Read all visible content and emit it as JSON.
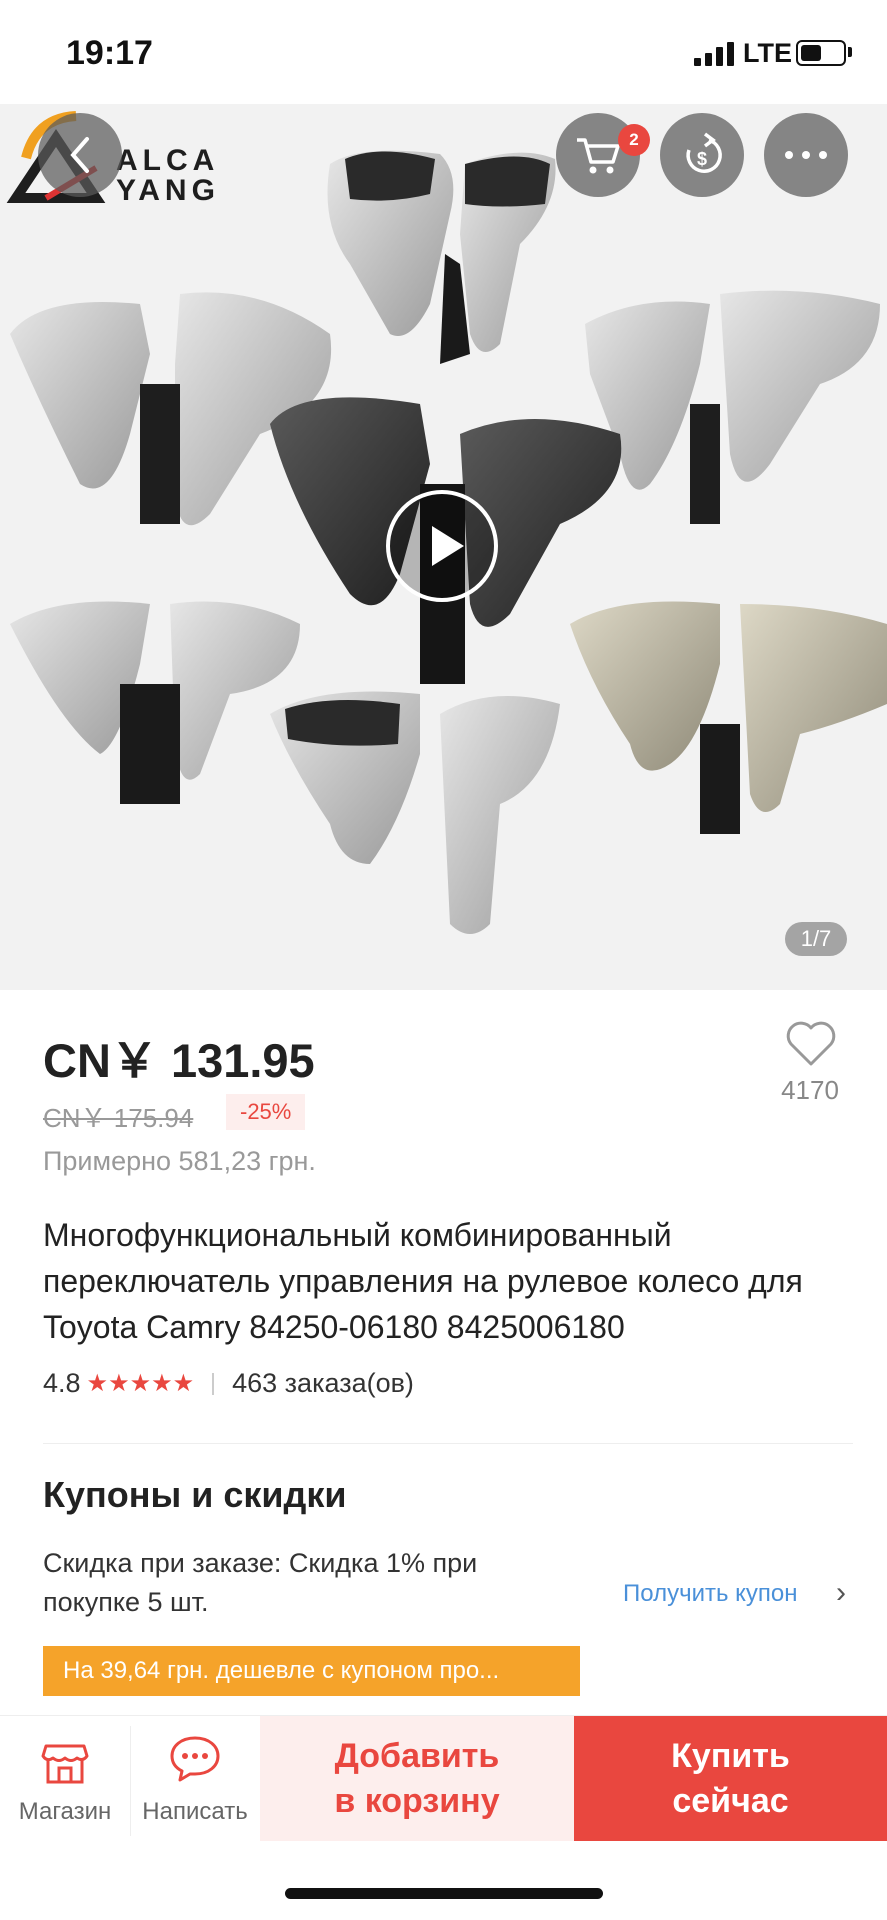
{
  "status_bar": {
    "time": "19:17",
    "network": "LTE"
  },
  "hero": {
    "brand_line1": "ALCA",
    "brand_line2": "YANG",
    "cart_badge": "2",
    "image_counter": "1/7"
  },
  "product": {
    "price": "CN￥ 131.95",
    "old_price": "CN￥ 175.94",
    "discount": "-25%",
    "approx_price": "Примерно 581,23 грн.",
    "favorites_count": "4170",
    "title": "Многофункциональный комбинированный переключатель управления на рулевое колесо для Toyota Camry 84250-06180 8425006180",
    "rating": "4.8",
    "stars_value": 4.8,
    "orders": "463 заказа(ов)"
  },
  "coupons": {
    "heading": "Купоны и скидки",
    "discount_text": "Скидка при заказе: Скидка 1% при покупке 5 шт.",
    "get_coupon_label": "Получить купон",
    "banner": "На 39,64 грн. дешевле с купоном про..."
  },
  "bottom_bar": {
    "store_label": "Магазин",
    "message_label": "Написать",
    "add_to_cart": "Добавить в корзину",
    "buy_now": "Купить сейчас"
  },
  "colors": {
    "accent": "#e9473f",
    "coupon_banner": "#f5a32a",
    "link": "#4a90d9"
  }
}
